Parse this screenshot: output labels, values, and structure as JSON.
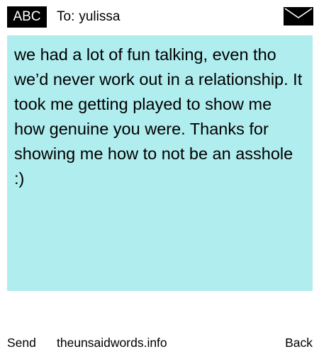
{
  "header": {
    "badge_label": "ABC",
    "to_label": "To:",
    "recipient": "yulissa",
    "icon": "envelope-icon"
  },
  "message": {
    "text": "we had a lot of fun talking, even tho we’d never work out in a relationship. It took me getting played to show me how genuine you were. Thanks for showing me how to not be an asshole :)",
    "background_color": "#b0edef"
  },
  "footer": {
    "send_label": "Send",
    "site_text": "theunsaidwords.info",
    "back_label": "Back"
  }
}
